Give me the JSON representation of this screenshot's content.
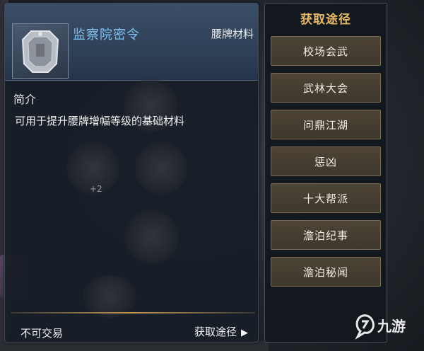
{
  "item": {
    "name": "监察院密令",
    "category": "腰牌材料",
    "icon": "silver-token-icon",
    "section_title": "简介",
    "description": "可用于提升腰牌增幅等级的基础材料",
    "trade_status": "不可交易",
    "source_link_label": "获取途径"
  },
  "source_panel": {
    "title": "获取途径",
    "options": [
      "校场会武",
      "武林大会",
      "问鼎江湖",
      "惩凶",
      "十大帮派",
      "澹泊纪事",
      "澹泊秘闻"
    ]
  },
  "watermark": {
    "text": "九游",
    "icon": "jiuyou-logo-icon"
  },
  "colors": {
    "item_name": "#7fc0f0",
    "source_title": "#e6b86a",
    "divider": "#c89a54"
  }
}
